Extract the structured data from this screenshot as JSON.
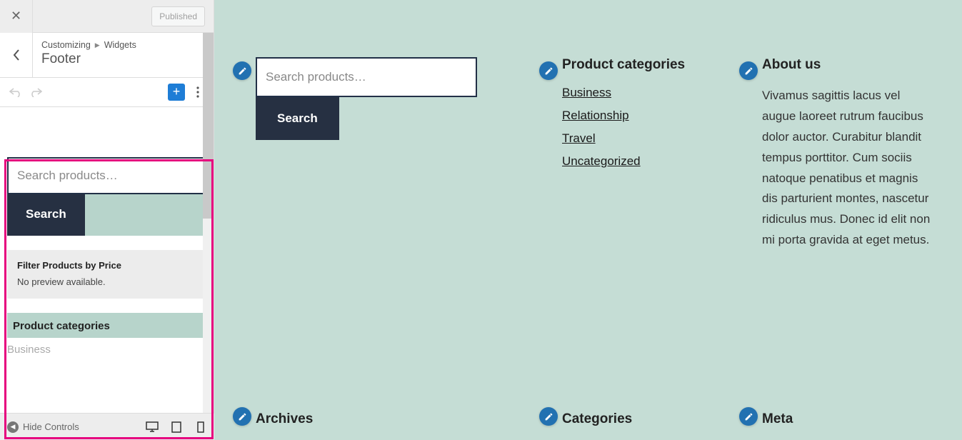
{
  "customizer": {
    "published_label": "Published",
    "breadcrumb_root": "Customizing",
    "breadcrumb_leaf": "Widgets",
    "panel_name": "Footer",
    "add_block_glyph": "+",
    "widget_editor": {
      "search_placeholder": "Search products…",
      "search_btn": "Search",
      "filter_title": "Filter Products by Price",
      "filter_sub": "No preview available.",
      "prod_cat_heading": "Product categories",
      "prod_cat_first": "Business"
    },
    "hide_controls": "Hide Controls"
  },
  "preview": {
    "search": {
      "placeholder": "Search products…",
      "button": "Search"
    },
    "product_categories": {
      "heading": "Product categories",
      "items": [
        "Business",
        "Relationship",
        "Travel",
        "Uncategorized"
      ]
    },
    "about": {
      "heading": "About us",
      "body": "Vivamus sagittis lacus vel augue laoreet rutrum faucibus dolor auctor. Curabitur blandit tempus porttitor. Cum sociis natoque penatibus et magnis dis parturient montes, nascetur ridiculus mus. Donec id elit non mi porta gravida at eget metus."
    },
    "row2": [
      "Archives",
      "Categories",
      "Meta"
    ]
  }
}
